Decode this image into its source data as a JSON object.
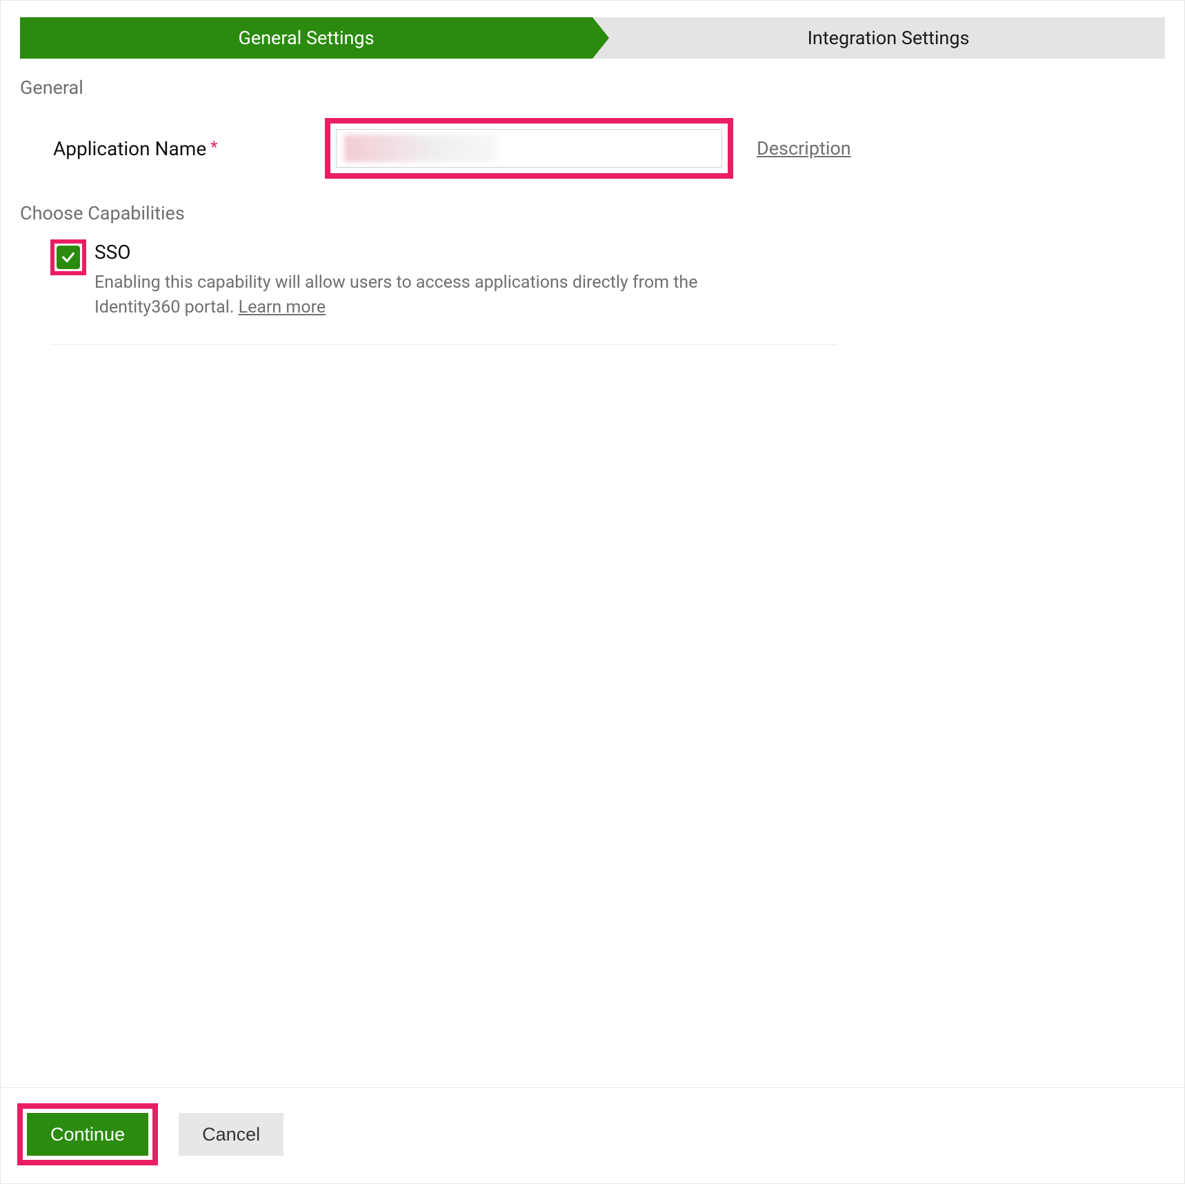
{
  "stepper": {
    "active": "General Settings",
    "inactive": "Integration Settings"
  },
  "general": {
    "section_title": "General",
    "app_name_label": "Application Name",
    "app_name_value": "",
    "description_link": "Description"
  },
  "capabilities": {
    "section_title": "Choose Capabilities",
    "sso": {
      "label": "SSO",
      "checked": true,
      "description": "Enabling this capability will allow users to access applications directly from the Identity360 portal. ",
      "learn_more": "Learn more"
    }
  },
  "footer": {
    "continue": "Continue",
    "cancel": "Cancel"
  },
  "highlight_color": "#e91e63",
  "accent_color": "#2b8b0e"
}
